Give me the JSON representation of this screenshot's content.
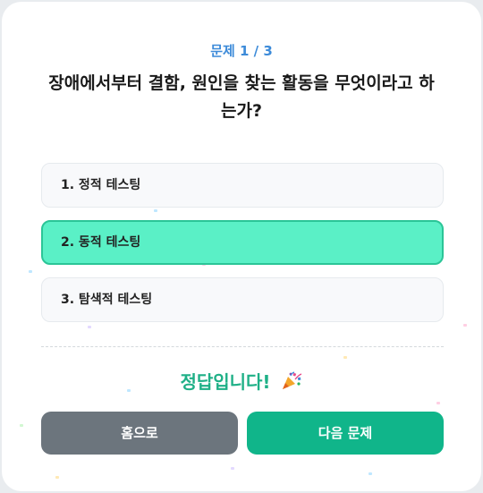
{
  "quiz": {
    "progress": "문제 1 / 3",
    "question": "장애에서부터 결함, 원인을 찾는 활동을 무엇이라고 하는가?",
    "options": [
      {
        "label": "1. 정적 테스팅",
        "selected": false
      },
      {
        "label": "2. 동적 테스팅",
        "selected": true
      },
      {
        "label": "3. 탐색적 테스팅",
        "selected": false
      }
    ],
    "result_text": "정답입니다!",
    "result_icon": "party-popper-icon"
  },
  "buttons": {
    "home_label": "홈으로",
    "next_label": "다음 문제"
  },
  "colors": {
    "accent": "#3d8bd9",
    "selected_option": "#5af0c6",
    "correct_text": "#1fb087",
    "home_button": "#6c757d",
    "next_button": "#10b58a"
  }
}
